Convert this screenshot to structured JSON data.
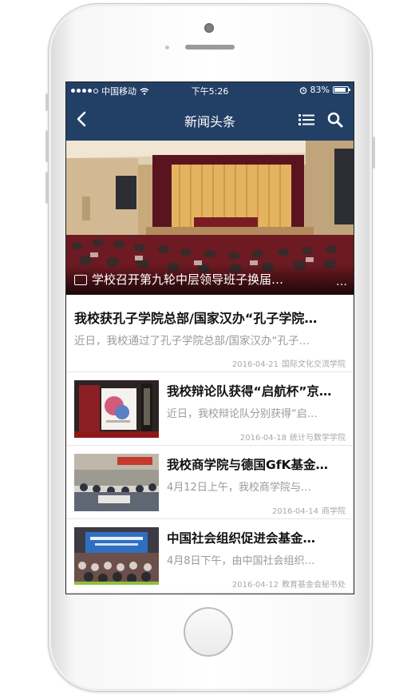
{
  "status": {
    "carrier": "中国移动",
    "time": "下午5:26",
    "battery": "83%"
  },
  "nav": {
    "title": "新闻头条"
  },
  "hero": {
    "caption": "学校召开第九轮中层领导班子换届…",
    "more": "…"
  },
  "feature": {
    "title": "我校获孔子学院总部/国家汉办“孔子学院…",
    "summary": "近日，我校通过了孔子学院总部/国家汉办“孔子…",
    "date": "2016-04-21",
    "department": "国际文化交流学院"
  },
  "articles": [
    {
      "title": "我校辩论队获得“启航杯”京…",
      "summary": "近日，我校辩论队分别获得“启…",
      "date": "2016-04-18",
      "department": "统计与数学学院"
    },
    {
      "title": "我校商学院与德国GfK基金…",
      "summary": "4月12日上午，我校商学院与…",
      "date": "2016-04-14",
      "department": "商学院"
    },
    {
      "title": "中国社会组织促进会基金…",
      "summary": "4月8日下午，由中国社会组织…",
      "date": "2016-04-12",
      "department": "教育基金会秘书处"
    }
  ],
  "colors": {
    "nav_bg": "#223f66",
    "title_text": "#111111",
    "summary_text": "#9a9a9a",
    "meta_text": "#a8a8a8"
  },
  "icons": {
    "back": "chevron-left-icon",
    "list": "list-icon",
    "search": "search-icon",
    "image": "image-icon",
    "wifi": "wifi-icon",
    "alarm": "alarm-icon",
    "battery": "battery-icon"
  }
}
